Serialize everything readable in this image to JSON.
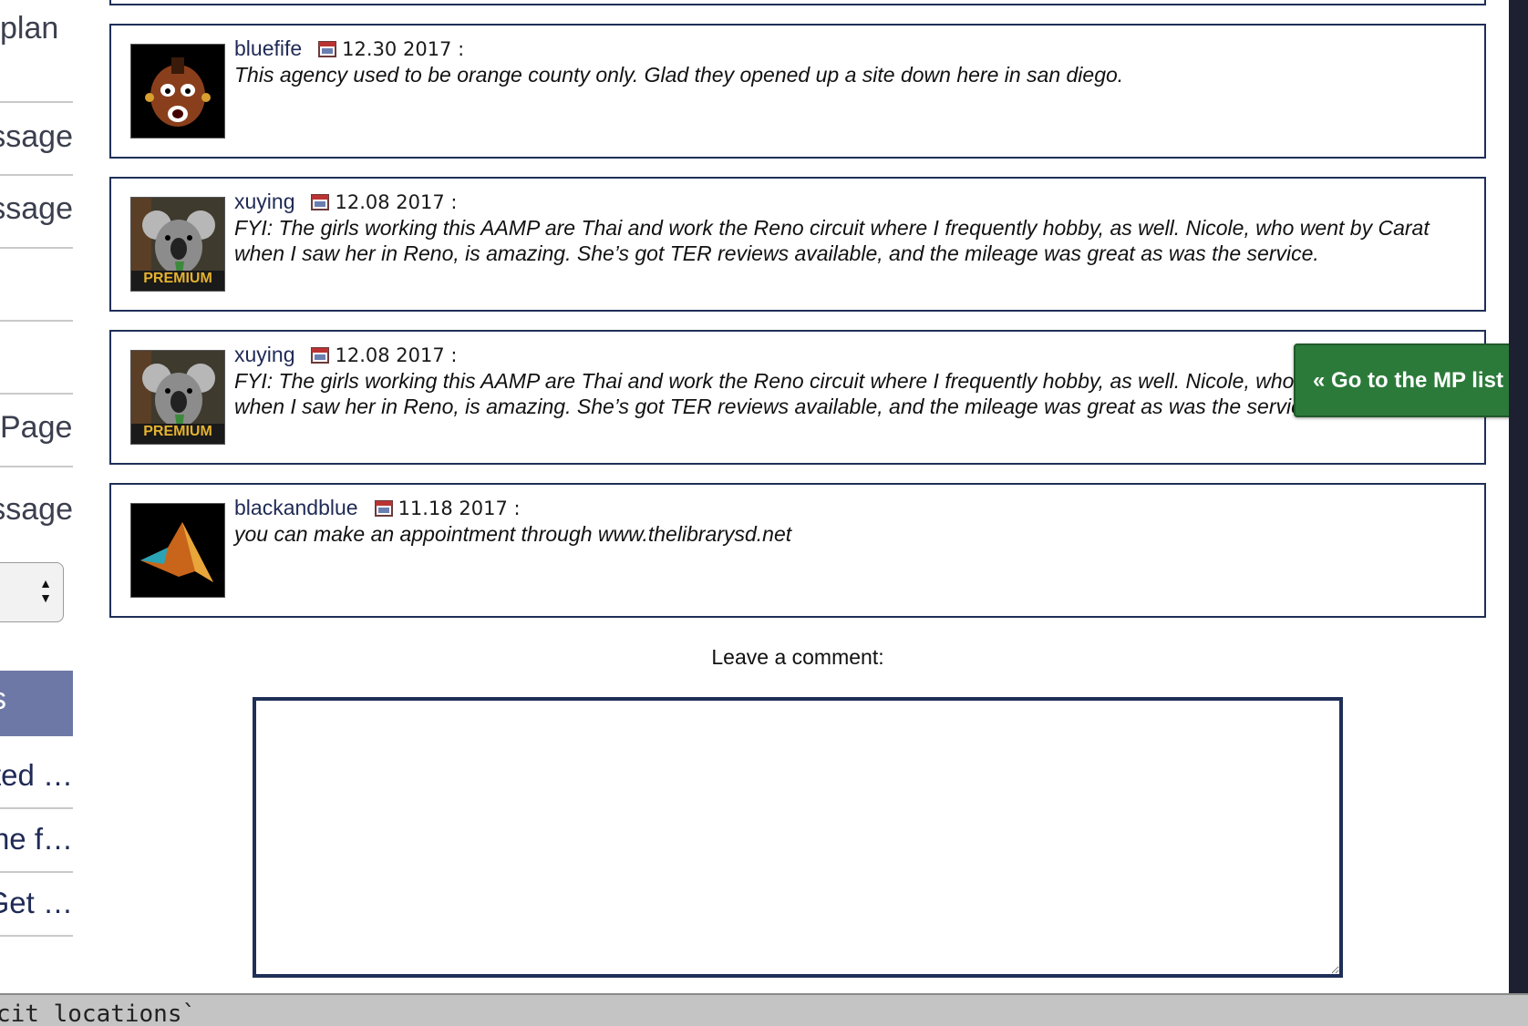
{
  "sidebar": {
    "items": [
      {
        "text": "plan"
      },
      {
        "text": "Message"
      },
      {
        "text": "Message"
      },
      {
        "text": ""
      },
      {
        "text": ""
      },
      {
        "text": "Page"
      },
      {
        "text": "Message"
      }
    ],
    "active_label": "s",
    "links": [
      {
        "text": "Posted …"
      },
      {
        "text": "The f…"
      },
      {
        "text": "Get …"
      }
    ]
  },
  "comments": [
    {
      "user": "bluefife",
      "date": "12.30 2017 :",
      "text": "This agency used to be orange county only. Glad they opened up a site down here in san diego.",
      "avatar": "mr-t-avatar"
    },
    {
      "user": "xuying",
      "date": "12.08 2017 :",
      "text": "FYI: The girls working this AAMP are Thai and work the Reno circuit where I frequently hobby, as well. Nicole, who went by Carat when I saw her in Reno, is amazing. She’s got TER reviews available, and the mileage was great as was the service.",
      "avatar": "koala-avatar",
      "badge": "PREMIUM"
    },
    {
      "user": "xuying",
      "date": "12.08 2017 :",
      "text": "FYI: The girls working this AAMP are Thai and work the Reno circuit where I frequently hobby, as well. Nicole, who went by Carat when I saw her in Reno, is amazing. She’s got TER reviews available, and the mileage was great as was the service.",
      "avatar": "koala-avatar",
      "badge": "PREMIUM"
    },
    {
      "user": "blackandblue",
      "date": "11.18 2017 :",
      "text": "you can make an appointment through www.thelibrarysd.net",
      "avatar": "matlab-logo-avatar"
    }
  ],
  "comment_form": {
    "label": "Leave a comment:",
    "value": ""
  },
  "mp_button": {
    "label": "« Go to the MP list"
  },
  "terminal": {
    "text": "cit_locations`"
  },
  "colors": {
    "border": "#1f2f57",
    "button": "#2c7a3a",
    "sidebar_active": "#6e78a6"
  }
}
